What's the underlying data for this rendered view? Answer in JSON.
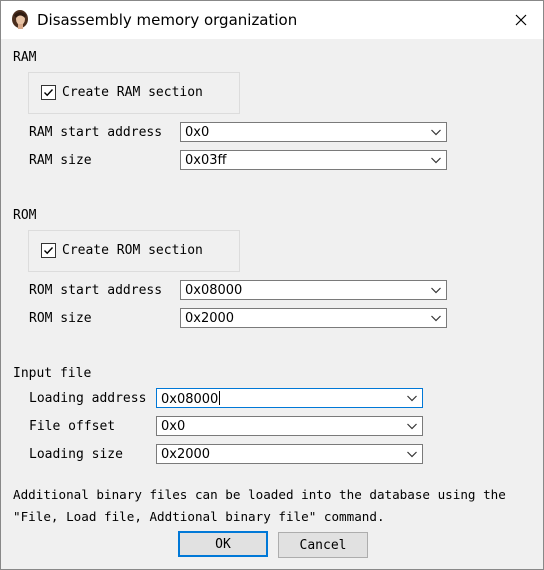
{
  "window": {
    "title": "Disassembly memory organization"
  },
  "ram": {
    "section_label": "RAM",
    "create_checkbox_label": "Create RAM section",
    "create_checked": true,
    "start_label": "RAM start address",
    "start_value": "0x0",
    "size_label": "RAM size",
    "size_value": "0x03ff"
  },
  "rom": {
    "section_label": "ROM",
    "create_checkbox_label": "Create ROM section",
    "create_checked": true,
    "start_label": "ROM start address",
    "start_value": "0x08000",
    "size_label": "ROM size",
    "size_value": "0x2000"
  },
  "input_file": {
    "section_label": "Input file",
    "loading_address_label": "Loading address",
    "loading_address_value": "0x08000",
    "file_offset_label": "File offset",
    "file_offset_value": "0x0",
    "loading_size_label": "Loading size",
    "loading_size_value": "0x2000"
  },
  "note": {
    "line1": "Additional binary files can be loaded into the database using the",
    "line2": "\"File, Load file, Addtional binary file\" command."
  },
  "buttons": {
    "ok_label": "OK",
    "cancel_label": "Cancel"
  },
  "icons": {
    "app": "app-avatar-icon",
    "close": "close-icon",
    "checkmark": "checkmark-icon",
    "dropdown": "chevron-down-icon"
  }
}
